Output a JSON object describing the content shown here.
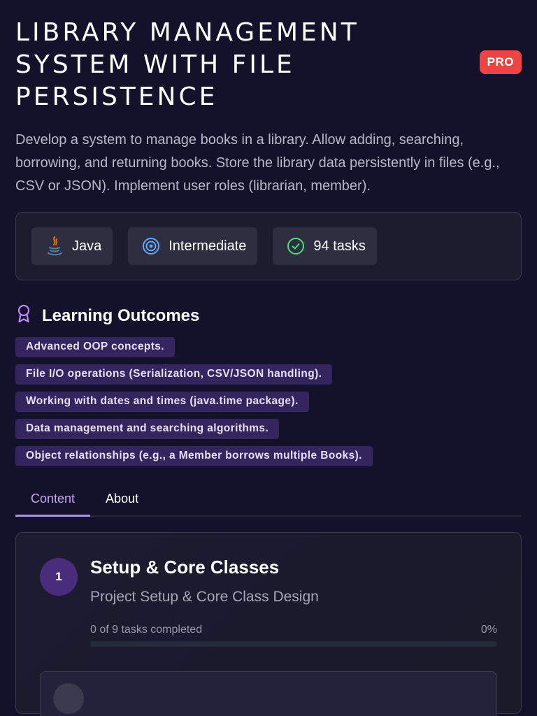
{
  "header": {
    "title": "LIBRARY MANAGEMENT SYSTEM WITH FILE PERSISTENCE",
    "badge": "PRO",
    "description": "Develop a system to manage books in a library. Allow adding, searching, borrowing, and returning books. Store the library data persistently in files (e.g., CSV or JSON). Implement user roles (librarian, member)."
  },
  "meta": {
    "language": "Java",
    "language_icon": "java-icon",
    "level": "Intermediate",
    "level_icon": "target-icon",
    "tasks": "94 tasks",
    "tasks_icon": "check-circle-icon"
  },
  "outcomes": {
    "title": "Learning Outcomes",
    "icon": "award-icon",
    "items": [
      "Advanced OOP concepts.",
      "File I/O operations (Serialization, CSV/JSON handling).",
      "Working with dates and times (java.time package).",
      "Data management and searching algorithms.",
      "Object relationships (e.g., a Member borrows multiple Books)."
    ]
  },
  "tabs": [
    {
      "label": "Content",
      "active": true
    },
    {
      "label": "About",
      "active": false
    }
  ],
  "module": {
    "number": "1",
    "title": "Setup & Core Classes",
    "subtitle": "Project Setup & Core Class Design",
    "progress_text": "0 of 9 tasks completed",
    "progress_percent": "0%",
    "progress_value": 0
  },
  "colors": {
    "background": "#13122a",
    "accent": "#b48ee8",
    "badge": "#ef4444",
    "tag_bg": "#35255e"
  }
}
